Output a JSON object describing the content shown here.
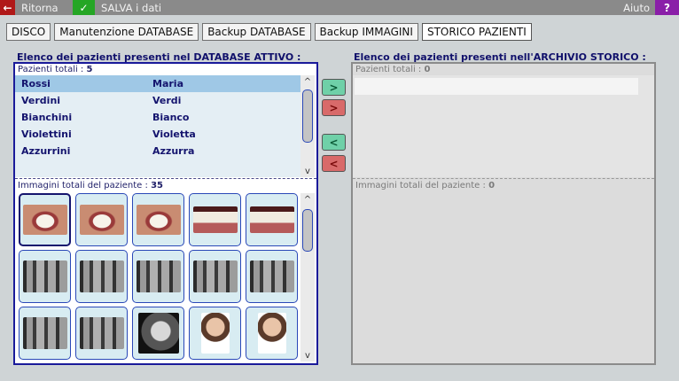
{
  "toolbar": {
    "back_label": "Ritorna",
    "save_label": "SALVA i dati",
    "help_label": "Aiuto",
    "back_icon": "←",
    "save_icon": "✓",
    "help_icon": "?"
  },
  "tabs": [
    {
      "label": "DISCO"
    },
    {
      "label": "Manutenzione DATABASE"
    },
    {
      "label": "Backup DATABASE"
    },
    {
      "label": "Backup IMMAGINI"
    },
    {
      "label": "STORICO PAZIENTI",
      "active": true
    }
  ],
  "left": {
    "title": "Elenco dei pazienti presenti nel DATABASE ATTIVO :",
    "patients_label": "Pazienti totali :",
    "patients_count": "5",
    "patients": [
      {
        "last": "Rossi",
        "first": "Maria",
        "selected": true
      },
      {
        "last": "Verdini",
        "first": "Verdi"
      },
      {
        "last": "Bianchini",
        "first": "Bianco"
      },
      {
        "last": "Violettini",
        "first": "Violetta"
      },
      {
        "last": "Azzurrini",
        "first": "Azzurra"
      }
    ],
    "images_label": "Immagini totali del paziente :",
    "images_count": "35",
    "images": [
      "smile",
      "smile",
      "smile",
      "teeth",
      "teeth",
      "xray",
      "xray",
      "xray",
      "xray",
      "xray",
      "xray",
      "xray",
      "ceph",
      "face",
      "face"
    ]
  },
  "right": {
    "title": "Elenco dei pazienti presenti nell'ARCHIVIO STORICO :",
    "patients_label": "Pazienti totali :",
    "patients_count": "0",
    "images_label": "Immagini totali del paziente :",
    "images_count": "0"
  },
  "transfer": {
    "move_right_one": ">",
    "move_right_all": ">",
    "move_left_one": "<",
    "move_left_all": "<"
  },
  "scroll_icons": {
    "up": "^",
    "down": "v"
  }
}
